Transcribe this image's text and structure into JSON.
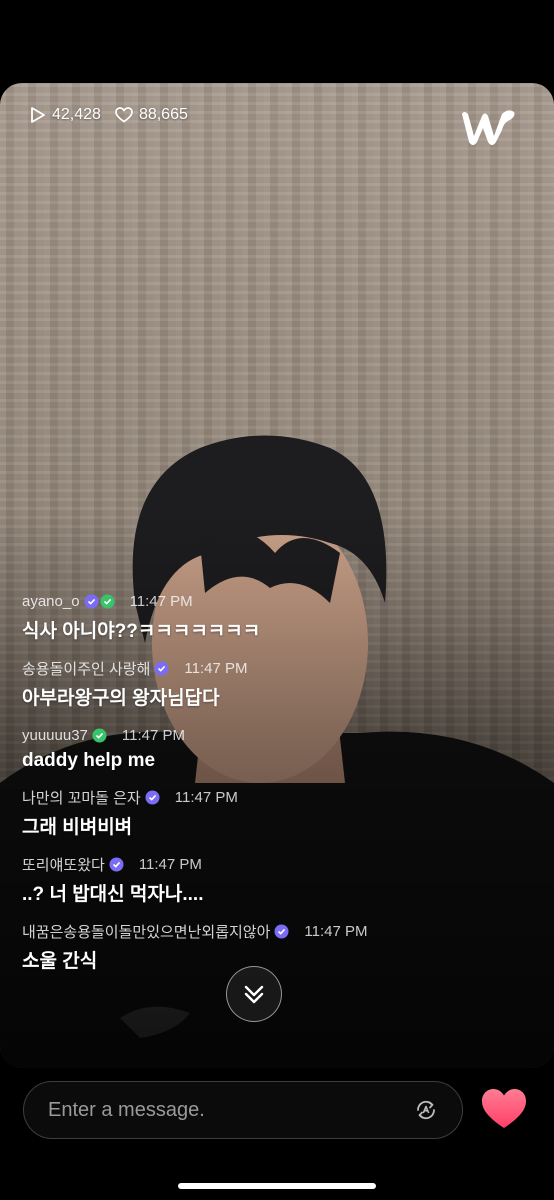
{
  "stats": {
    "views": "42,428",
    "likes": "88,665"
  },
  "brand": {
    "logo_icon": "weverse-w-icon"
  },
  "chat": [
    {
      "name": "ayano_o",
      "badges": [
        "purple",
        "green"
      ],
      "time": "11:47 PM",
      "text": "식사 아니야??ㅋㅋㅋㅋㅋㅋㅋ"
    },
    {
      "name": "송용돌이주인 사랑해",
      "badges": [
        "purple"
      ],
      "time": "11:47 PM",
      "text": "아부라왕구의 왕자님답다"
    },
    {
      "name": "yuuuuu37",
      "badges": [
        "green"
      ],
      "time": "11:47 PM",
      "text": "daddy help me"
    },
    {
      "name": "나만의 꼬마돌 은자",
      "badges": [
        "purple"
      ],
      "time": "11:47 PM",
      "text": "그래 비벼비벼"
    },
    {
      "name": "또리얘또왔다",
      "badges": [
        "purple"
      ],
      "time": "11:47 PM",
      "text": "..? 너 밥대신 먹자나...."
    },
    {
      "name": "내꿈은송용돌이돌만있으면난외롭지않아",
      "badges": [
        "purple"
      ],
      "time": "11:47 PM",
      "text": "소울 간식"
    }
  ],
  "input": {
    "placeholder": "Enter a message."
  },
  "colors": {
    "heart": "#ff5a7a",
    "badge_purple": "#7b6cf6",
    "badge_green": "#39c36a"
  }
}
